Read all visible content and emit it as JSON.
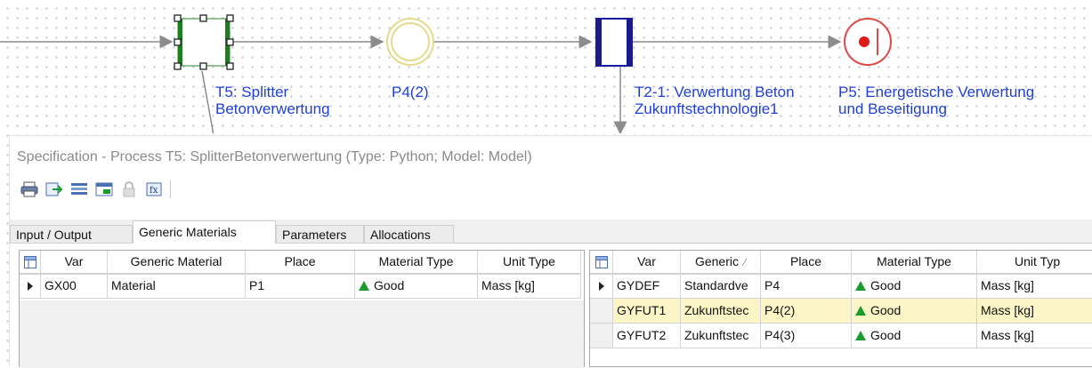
{
  "diagram": {
    "t5_label": "T5: Splitter\nBetonverwertung",
    "p4_label": "P4(2)",
    "t2_label": "T2-1: Verwertung Beton\nZukunftstechnologie1",
    "p5_label": "P5: Energetische Verwertung\nund Beseitigung"
  },
  "dialog": {
    "title": "Specification - Process T5: SplitterBetonverwertung (Type: Python; Model: Model)",
    "toolbar": [
      "print-icon",
      "export-icon",
      "columns-icon",
      "window-icon",
      "lock-icon",
      "formula-icon"
    ],
    "tabs": [
      "Input / Output",
      "Generic Materials",
      "Parameters",
      "Allocations"
    ],
    "active_tab": "Generic Materials"
  },
  "left_table": {
    "headers": [
      "Var",
      "Generic Material",
      "Place",
      "Material Type",
      "Unit Type"
    ],
    "rows": [
      {
        "var": "GX00",
        "generic": "Material",
        "place": "P1",
        "material_type": "Good",
        "unit_type": "Mass [kg]"
      }
    ]
  },
  "right_table": {
    "headers": [
      "Var",
      "Generic",
      "Place",
      "Material Type",
      "Unit Typ"
    ],
    "sort_indicator": "⁄",
    "rows": [
      {
        "var": "GYDEF",
        "generic": "Standardve",
        "place": "P4",
        "material_type": "Good",
        "unit_type": "Mass [kg]"
      },
      {
        "var": "GYFUT1",
        "generic": "Zukunftstec",
        "place": "P4(2)",
        "material_type": "Good",
        "unit_type": "Mass [kg]"
      },
      {
        "var": "GYFUT2",
        "generic": "Zukunftstec",
        "place": "P4(3)",
        "material_type": "Good",
        "unit_type": "Mass [kg]"
      }
    ]
  },
  "colors": {
    "accent_blue": "#1f3fd6",
    "good_green": "#1a9c2c",
    "selected_row": "#fcf5c6"
  }
}
